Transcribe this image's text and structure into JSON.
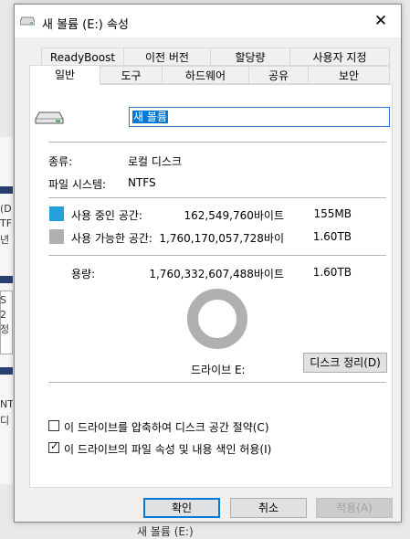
{
  "window": {
    "title": "새 볼륨 (E:) 속성",
    "close_glyph": "✕"
  },
  "tabs_row1": [
    "ReadyBoost",
    "이전 버전",
    "할당량",
    "사용자 지정"
  ],
  "tabs_row2": [
    "일반",
    "도구",
    "하드웨어",
    "공유",
    "보안"
  ],
  "active_tab": "일반",
  "general": {
    "volume_name": "새 볼륨",
    "type_label": "종류:",
    "type_value": "로컬 디스크",
    "fs_label": "파일 시스템:",
    "fs_value": "NTFS",
    "used_label": "사용 중인 공간:",
    "used_bytes": "162,549,760바이트",
    "used_size": "155MB",
    "free_label": "사용 가능한 공간:",
    "free_bytes": "1,760,170,057,728바이",
    "free_size": "1.60TB",
    "capacity_label": "용량:",
    "capacity_bytes": "1,760,332,607,488바이트",
    "capacity_size": "1.60TB",
    "drive_label": "드라이브 E:",
    "cleanup_button": "디스크 정리(D)",
    "compress_label": "이 드라이브를 압축하여 디스크 공간 절약(C)",
    "compress_checked": false,
    "index_label": "이 드라이브의 파일 속성 및 내용 색인 허용(I)",
    "index_checked": true,
    "used_fraction": 9.23e-05
  },
  "colors": {
    "used": "#26a0da",
    "free": "#b0b0b0",
    "accent": "#0078d7"
  },
  "buttons": {
    "ok": "확인",
    "cancel": "취소",
    "apply": "적용(A)"
  },
  "background": {
    "left_fragments": [
      "(D",
      "TF",
      "년",
      "S",
      "2",
      "정",
      "NT",
      "디"
    ],
    "bottom_text": "새 볼륨 (E:)"
  },
  "icons": {
    "title": "drive-icon",
    "drive": "hard-drive-icon",
    "close": "close-icon",
    "check": "checkmark-icon"
  }
}
